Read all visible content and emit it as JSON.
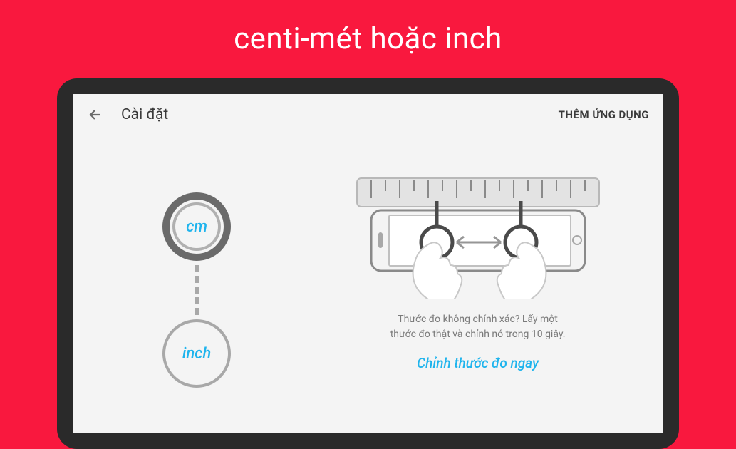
{
  "promo": {
    "title": "centi-mét hoặc inch"
  },
  "appbar": {
    "title": "Cài đặt",
    "action": "THÊM ỨNG DỤNG"
  },
  "units": {
    "cm": "cm",
    "inch": "inch"
  },
  "hint": {
    "line1": "Thước đo không chính xác? Lấy một",
    "line2": "thước đo thật và chỉnh nó trong 10 giây."
  },
  "calibrate": {
    "label": "Chỉnh thước đo ngay"
  }
}
